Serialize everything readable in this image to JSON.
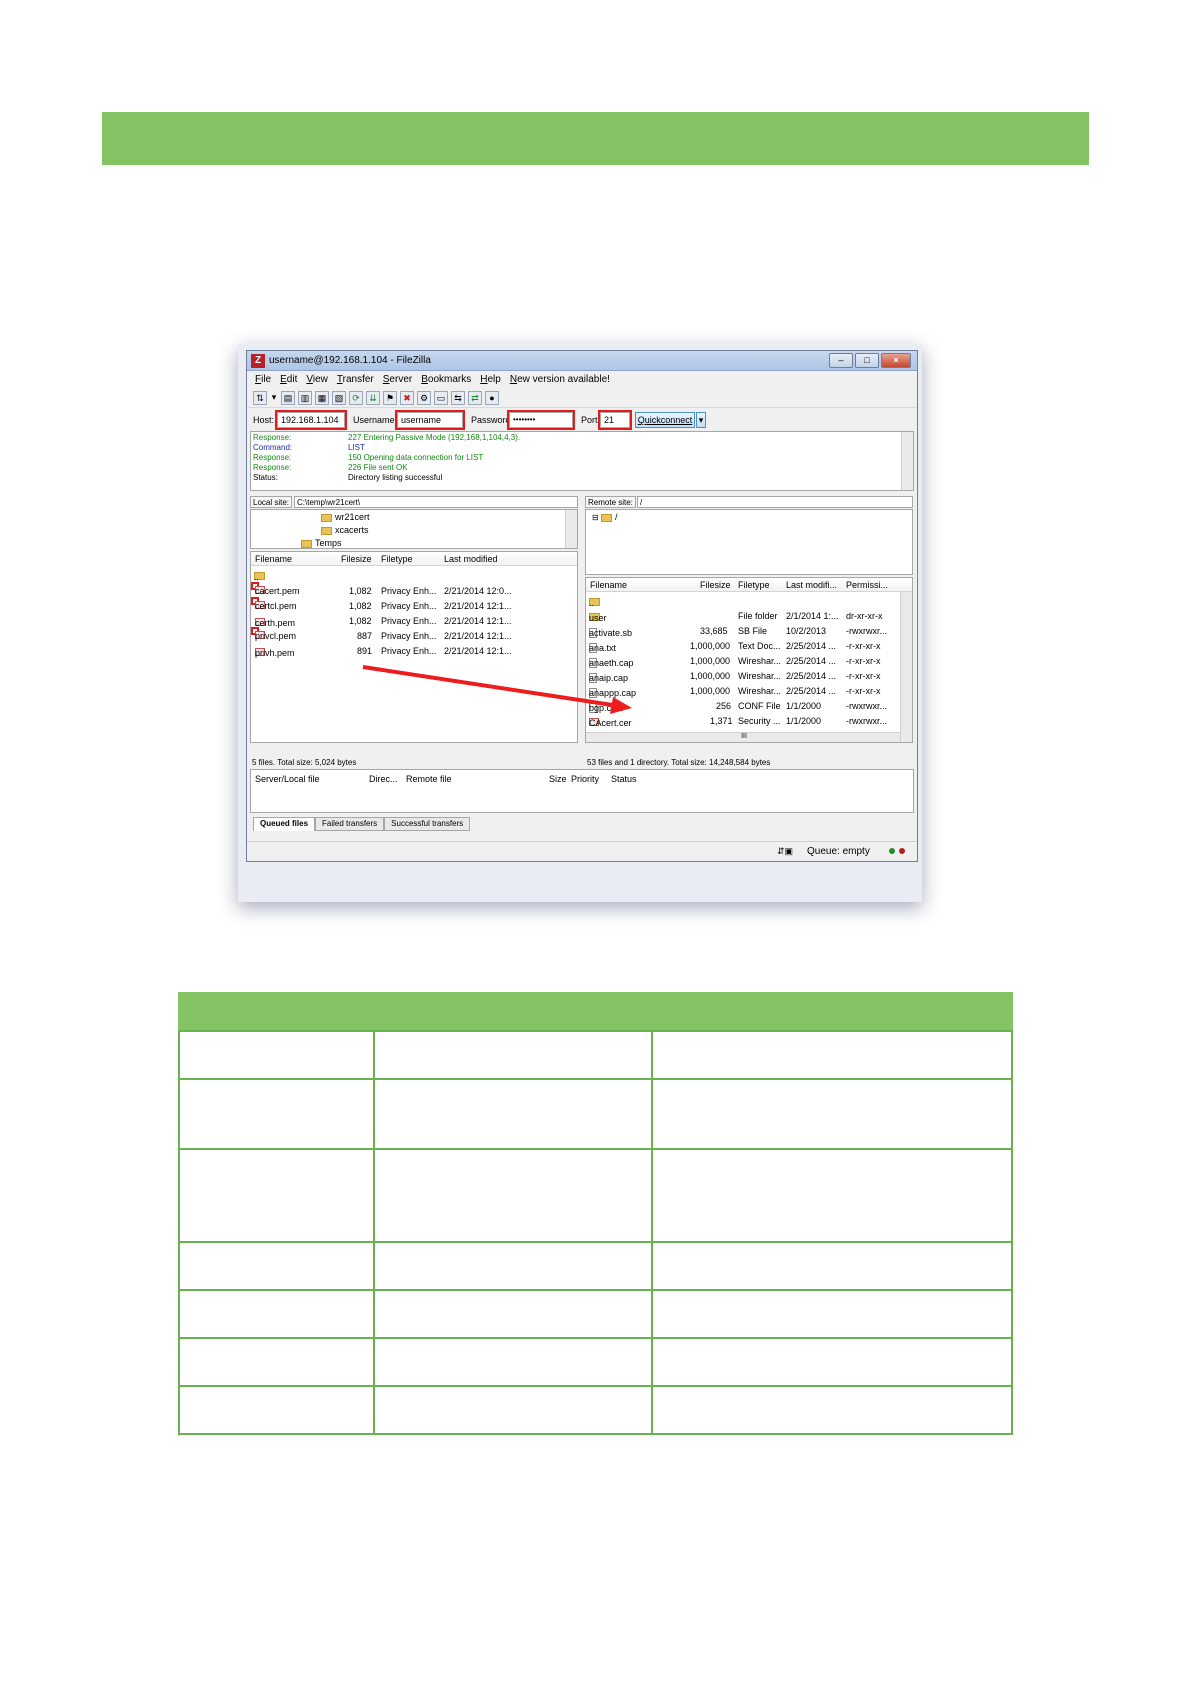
{
  "window": {
    "title": "username@192.168.1.104 - FileZilla"
  },
  "menu": [
    "File",
    "Edit",
    "View",
    "Transfer",
    "Server",
    "Bookmarks",
    "Help",
    "New version available!"
  ],
  "quickconnect": {
    "host_label": "Host:",
    "host_value": "192.168.1.104",
    "username_label": "Username:",
    "username_value": "username",
    "password_label": "Password:",
    "password_value": "••••••••",
    "port_label": "Port:",
    "port_value": "21",
    "button_label": "Quickconnect"
  },
  "log": [
    {
      "type": "Response:",
      "msg": "227 Entering Passive Mode (192,168,1,104,4,3)."
    },
    {
      "type": "Command:",
      "msg": "LIST"
    },
    {
      "type": "Response:",
      "msg": "150 Opening data connection for LIST"
    },
    {
      "type": "Response:",
      "msg": "226 File sent OK"
    },
    {
      "type": "Status:",
      "msg": "Directory listing successful"
    }
  ],
  "local": {
    "site_label": "Local site:",
    "site_path": "C:\\temp\\wr21cert\\",
    "tree": [
      "wr21cert",
      "xcacerts",
      "Temps"
    ],
    "headers": [
      "Filename",
      "Filesize",
      "Filetype",
      "Last modified"
    ],
    "parent": "..",
    "files": [
      {
        "name": "cacert.pem",
        "size": "1,082",
        "type": "Privacy Enh...",
        "modified": "2/21/2014 12:0..."
      },
      {
        "name": "certcl.pem",
        "size": "1,082",
        "type": "Privacy Enh...",
        "modified": "2/21/2014 12:1..."
      },
      {
        "name": "certh.pem",
        "size": "1,082",
        "type": "Privacy Enh...",
        "modified": "2/21/2014 12:1..."
      },
      {
        "name": "privcl.pem",
        "size": "887",
        "type": "Privacy Enh...",
        "modified": "2/21/2014 12:1..."
      },
      {
        "name": "privh.pem",
        "size": "891",
        "type": "Privacy Enh...",
        "modified": "2/21/2014 12:1..."
      }
    ],
    "status": "5 files. Total size: 5,024 bytes"
  },
  "remote": {
    "site_label": "Remote site:",
    "site_path": "/",
    "tree_root": "/",
    "headers": [
      "Filename",
      "Filesize",
      "Filetype",
      "Last modifi...",
      "Permissi..."
    ],
    "parent": "..",
    "files": [
      {
        "name": "user",
        "size": "",
        "type": "File folder",
        "modified": "2/1/2014 1:...",
        "perm": "dr-xr-xr-x"
      },
      {
        "name": "activate.sb",
        "size": "33,685",
        "type": "SB File",
        "modified": "10/2/2013",
        "perm": "-rwxrwxr..."
      },
      {
        "name": "ana.txt",
        "size": "1,000,000",
        "type": "Text Doc...",
        "modified": "2/25/2014 ...",
        "perm": "-r-xr-xr-x"
      },
      {
        "name": "anaeth.cap",
        "size": "1,000,000",
        "type": "Wireshar...",
        "modified": "2/25/2014 ...",
        "perm": "-r-xr-xr-x"
      },
      {
        "name": "anaip.cap",
        "size": "1,000,000",
        "type": "Wireshar...",
        "modified": "2/25/2014 ...",
        "perm": "-r-xr-xr-x"
      },
      {
        "name": "anappp.cap",
        "size": "1,000,000",
        "type": "Wireshar...",
        "modified": "2/25/2014 ...",
        "perm": "-r-xr-xr-x"
      },
      {
        "name": "bgp.conf",
        "size": "256",
        "type": "CONF File",
        "modified": "1/1/2000",
        "perm": "-rwxrwxr..."
      },
      {
        "name": "CAcert.cer",
        "size": "1,371",
        "type": "Security ...",
        "modified": "1/1/2000",
        "perm": "-rwxrwxr..."
      }
    ],
    "scroll_marker": "III",
    "status": "53 files and 1 directory. Total size: 14,248,584 bytes"
  },
  "queue": {
    "headers": [
      "Server/Local file",
      "Direc...",
      "Remote file",
      "Size",
      "Priority",
      "Status"
    ],
    "tabs": [
      "Queued files",
      "Failed transfers",
      "Successful transfers"
    ],
    "status": "Queue: empty"
  },
  "colors": {
    "accent_green": "#85c464",
    "highlight_red": "#e01b1b"
  }
}
